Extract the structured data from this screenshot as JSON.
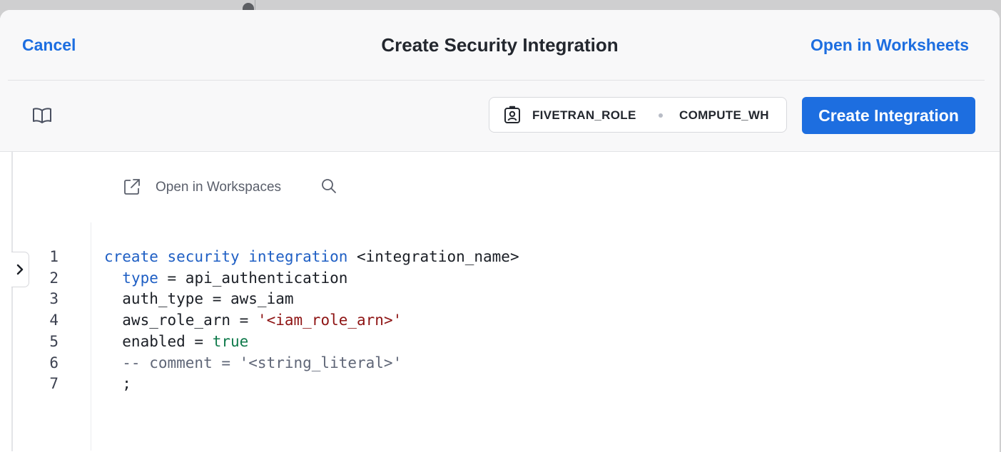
{
  "header": {
    "cancel_label": "Cancel",
    "title": "Create Security Integration",
    "open_worksheets_label": "Open in Worksheets"
  },
  "toolbar": {
    "docs_icon": "book-icon",
    "role": "FIVETRAN_ROLE",
    "warehouse": "COMPUTE_WH",
    "create_button_label": "Create Integration"
  },
  "editor": {
    "open_workspaces_label": "Open in Workspaces",
    "line_numbers": [
      "1",
      "2",
      "3",
      "4",
      "5",
      "6",
      "7"
    ],
    "lines": [
      [
        {
          "t": "create security integration",
          "c": "kw"
        },
        {
          "t": " <integration_name>",
          "c": "plain"
        }
      ],
      [
        {
          "t": "  ",
          "c": "plain"
        },
        {
          "t": "type",
          "c": "kw"
        },
        {
          "t": " = api_authentication",
          "c": "plain"
        }
      ],
      [
        {
          "t": "  auth_type = aws_iam",
          "c": "plain"
        }
      ],
      [
        {
          "t": "  aws_role_arn = ",
          "c": "plain"
        },
        {
          "t": "'<iam_role_arn>'",
          "c": "str"
        }
      ],
      [
        {
          "t": "  enabled = ",
          "c": "plain"
        },
        {
          "t": "true",
          "c": "bool"
        }
      ],
      [
        {
          "t": "  -- comment = '<string_literal>'",
          "c": "cmt"
        }
      ],
      [
        {
          "t": "  ;",
          "c": "plain"
        }
      ]
    ]
  },
  "colors": {
    "accent": "#1d6ee0",
    "keyword": "#1f5fc4",
    "string": "#8e1414",
    "boolean": "#0f7a4b",
    "comment": "#5f6677"
  }
}
